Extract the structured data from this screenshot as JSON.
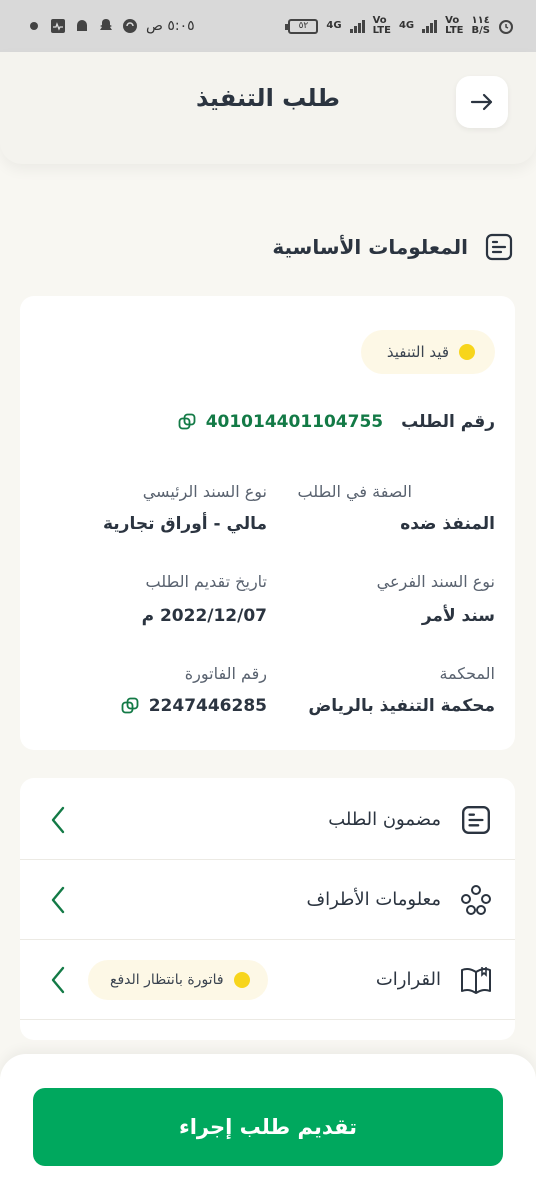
{
  "status_bar": {
    "time": "٥:٠٥ ص",
    "battery": "٥٢",
    "network_1": "4G",
    "network_2": "4G",
    "volte": "Vo\nLTE",
    "speed": "١١٤\nB/S"
  },
  "header": {
    "title": "طلب التنفيذ"
  },
  "section": {
    "title": "المعلومات الأساسية"
  },
  "info": {
    "status_badge": "قيد التنفيذ",
    "request_number_label": "رقم الطلب",
    "request_number": "401014401104755",
    "role_label": "الصفة في الطلب",
    "role_value": "المنفذ ضده",
    "main_doc_label": "نوع السند الرئيسي",
    "main_doc_value": "مالي - أوراق تجارية",
    "sub_doc_label": "نوع السند الفرعي",
    "sub_doc_value": "سند لأمر",
    "date_label": "تاريخ تقديم الطلب",
    "date_value": "2022/12/07 م",
    "court_label": "المحكمة",
    "court_value": "محكمة التنفيذ بالرياض",
    "invoice_label": "رقم الفاتورة",
    "invoice_value": "2247446285"
  },
  "nav": {
    "items": [
      {
        "label": "مضمون الطلب"
      },
      {
        "label": "معلومات الأطراف"
      },
      {
        "label": "القرارات",
        "badge": "فاتورة بانتظار الدفع"
      }
    ]
  },
  "actions": {
    "primary": "تقديم طلب إجراء"
  },
  "colors": {
    "accent_green": "#00a85e",
    "number_green": "#137a46",
    "status_yellow": "#f7d51c"
  }
}
